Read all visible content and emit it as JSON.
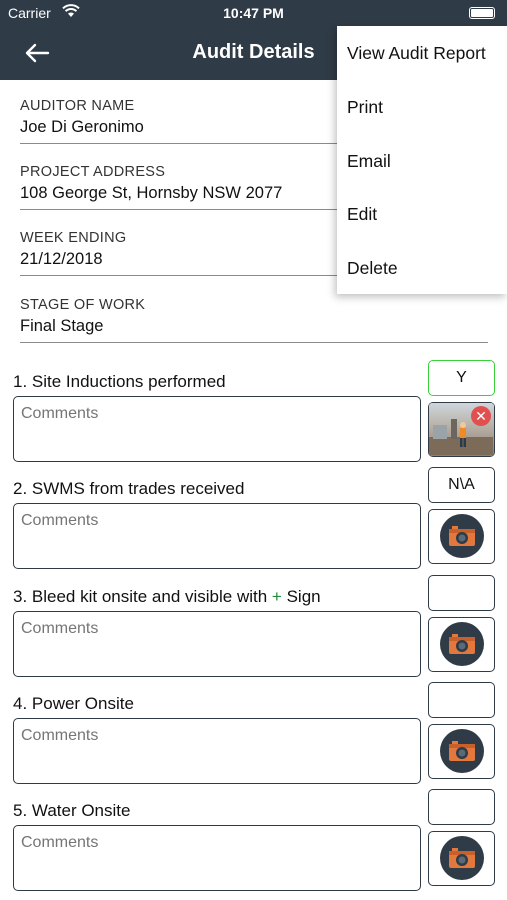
{
  "status": {
    "carrier": "Carrier",
    "time": "10:47 PM"
  },
  "nav": {
    "title": "Audit Details",
    "back_icon": "arrow-left-icon"
  },
  "fields": [
    {
      "label": "AUDITOR NAME",
      "value": "Joe Di Geronimo"
    },
    {
      "label": "PROJECT ADDRESS",
      "value": "108 George St, Hornsby NSW 2077"
    },
    {
      "label": "WEEK ENDING",
      "value": "21/12/2018"
    },
    {
      "label": "STAGE OF WORK",
      "value": "Final Stage"
    }
  ],
  "questions": [
    {
      "text": "1. Site Inductions performed",
      "answer": "Y",
      "comment_placeholder": "Comments",
      "photo": "thumbnail"
    },
    {
      "text": "2. SWMS from trades received",
      "answer": "N\\A",
      "comment_placeholder": "Comments",
      "photo": "camera"
    },
    {
      "text_before": "3. Bleed kit onsite and visible with ",
      "plus": "+",
      "text_after": " Sign",
      "answer": "",
      "comment_placeholder": "Comments",
      "photo": "camera"
    },
    {
      "text": "4. Power Onsite",
      "answer": "",
      "comment_placeholder": "Comments",
      "photo": "camera"
    },
    {
      "text": "5. Water Onsite",
      "answer": "",
      "comment_placeholder": "Comments",
      "photo": "camera"
    }
  ],
  "menu": {
    "items": [
      "View Audit Report",
      "Print",
      "Email",
      "Edit",
      "Delete"
    ]
  },
  "colors": {
    "header": "#2f3b46",
    "selected_border": "#39d139",
    "remove": "#e0504e",
    "camera_body": "#e2783e"
  }
}
